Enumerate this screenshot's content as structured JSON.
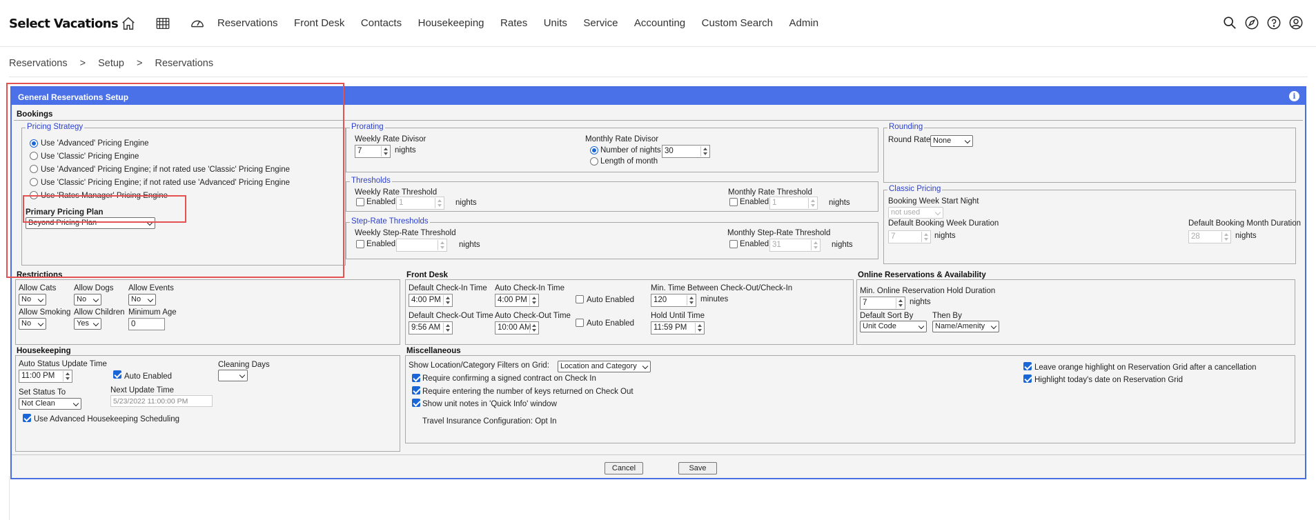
{
  "brand": "Select Vacations",
  "nav_icons": [
    "home-icon",
    "calendar-grid-icon",
    "dashboard-gauge-icon"
  ],
  "menu": [
    "Reservations",
    "Front Desk",
    "Contacts",
    "Housekeeping",
    "Rates",
    "Units",
    "Service",
    "Accounting",
    "Custom Search",
    "Admin"
  ],
  "right_icons": [
    "search-icon",
    "compass-icon",
    "help-icon",
    "user-icon"
  ],
  "breadcrumb": [
    "Reservations",
    "Setup",
    "Reservations"
  ],
  "breadcrumb_sep": ">",
  "panel_title": "General Reservations Setup",
  "info_glyph": "i",
  "bookings": {
    "title": "Bookings",
    "pricing_legend": "Pricing Strategy",
    "options": [
      "Use 'Advanced' Pricing Engine",
      "Use 'Classic' Pricing Engine",
      "Use 'Advanced' Pricing Engine; if not rated use 'Classic' Pricing Engine",
      "Use 'Classic' Pricing Engine; if not rated use 'Advanced' Pricing Engine",
      "Use 'Rates Manager' Pricing Engine"
    ],
    "selected_index": 0,
    "primary_plan_label": "Primary Pricing Plan",
    "primary_plan_value": "Beyond Pricing Plan"
  },
  "prorating": {
    "legend": "Prorating",
    "weekly_label": "Weekly Rate Divisor",
    "weekly_value": "7",
    "nights": "nights",
    "monthly_label": "Monthly Rate Divisor",
    "number_of_nights": "Number of nights",
    "monthly_value": "30",
    "length_of_month": "Length of month"
  },
  "thresholds": {
    "legend": "Thresholds",
    "weekly_label": "Weekly Rate Threshold",
    "monthly_label": "Monthly Rate Threshold",
    "enabled": "Enabled",
    "weekly_value": "1",
    "monthly_value": "1",
    "nights": "nights"
  },
  "step": {
    "legend": "Step-Rate Thresholds",
    "weekly_label": "Weekly Step-Rate Threshold",
    "monthly_label": "Monthly Step-Rate Threshold",
    "enabled": "Enabled",
    "weekly_value": "",
    "monthly_value": "31",
    "nights": "nights"
  },
  "rounding": {
    "legend": "Rounding",
    "label": "Round Rate",
    "value": "None"
  },
  "classic": {
    "legend": "Classic Pricing",
    "start_label": "Booking Week Start Night",
    "start_value": "not used",
    "week_label": "Default Booking Week Duration",
    "week_value": "7",
    "month_label": "Default Booking Month Duration",
    "month_value": "28",
    "nights": "nights"
  },
  "restrictions": {
    "title": "Restrictions",
    "cats_label": "Allow Cats",
    "cats_value": "No",
    "dogs_label": "Allow Dogs",
    "dogs_value": "No",
    "events_label": "Allow Events",
    "events_value": "No",
    "smoking_label": "Allow Smoking",
    "smoking_value": "No",
    "children_label": "Allow Children",
    "children_value": "Yes",
    "age_label": "Minimum Age",
    "age_value": "0"
  },
  "frontdesk": {
    "title": "Front Desk",
    "checkin_label": "Default Check-In Time",
    "checkin_value": "4:00 PM",
    "auto_checkin_label": "Auto Check-In Time",
    "auto_checkin_value": "4:00 PM",
    "auto_enabled": "Auto Enabled",
    "checkout_label": "Default Check-Out Time",
    "checkout_value": "9:56 AM",
    "auto_checkout_label": "Auto Check-Out Time",
    "auto_checkout_value": "10:00 AM",
    "min_time_label": "Min. Time Between Check-Out/Check-In",
    "min_time_value": "120",
    "minutes": "minutes",
    "hold_label": "Hold Until Time",
    "hold_value": "11:59 PM"
  },
  "online": {
    "title": "Online Reservations & Availability",
    "hold_label": "Min. Online Reservation Hold Duration",
    "hold_value": "7",
    "nights": "nights",
    "sort_label": "Default Sort By",
    "sort_value": "Unit Code",
    "then_label": "Then By",
    "then_value": "Name/Amenity"
  },
  "housekeeping": {
    "title": "Housekeeping",
    "auto_status_label": "Auto Status Update Time",
    "auto_status_value": "11:00 PM",
    "auto_enabled": "Auto Enabled",
    "cleaning_label": "Cleaning Days",
    "cleaning_value": "",
    "set_status_label": "Set Status To",
    "set_status_value": "Not Clean",
    "next_update_label": "Next Update Time",
    "next_update_value": "5/23/2022 11:00:00 PM",
    "advanced": "Use Advanced Housekeeping Scheduling"
  },
  "misc": {
    "title": "Miscellaneous",
    "filters_label": "Show Location/Category Filters on Grid:",
    "filters_value": "Location and Category",
    "signed_contract": "Require confirming a signed contract on Check In",
    "keys_returned": "Require entering the number of keys returned on Check Out",
    "unit_notes": "Show unit notes in 'Quick Info' window",
    "travel_insurance": "Travel Insurance Configuration: Opt In",
    "orange_highlight": "Leave orange highlight on Reservation Grid after a cancellation",
    "today_highlight": "Highlight today's date on Reservation Grid"
  },
  "buttons": {
    "cancel": "Cancel",
    "save": "Save"
  }
}
